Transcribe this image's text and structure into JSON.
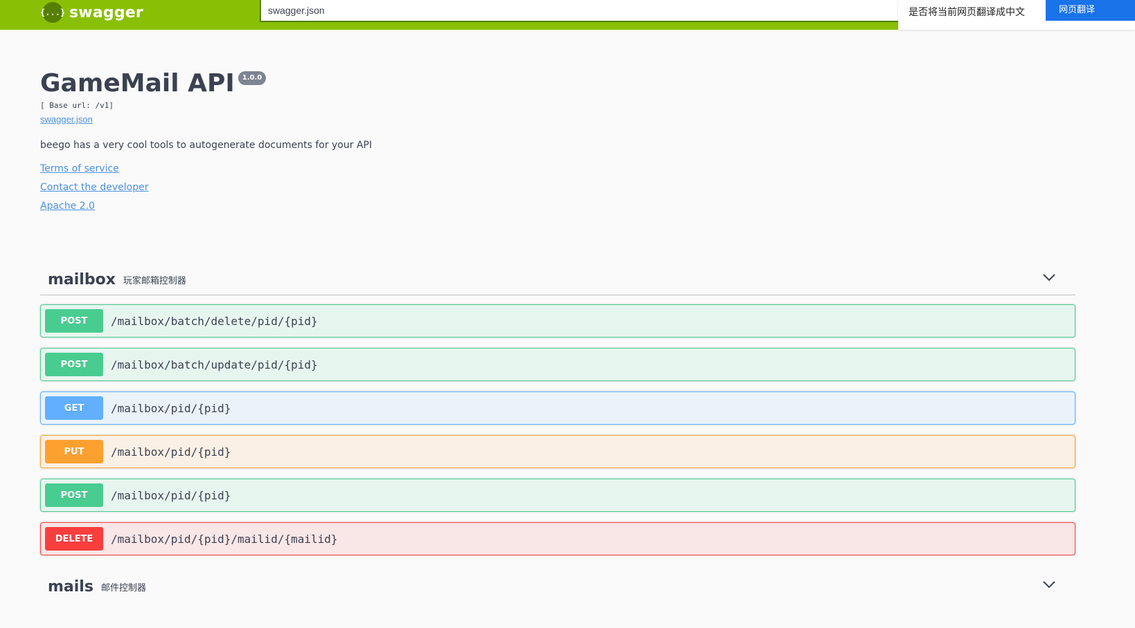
{
  "topbar": {
    "logo_icon_text": "{...}",
    "logo_text": "swagger",
    "url_value": "swagger.json"
  },
  "translate": {
    "prompt": "是否将当前网页翻译成中文",
    "button": "网页翻译"
  },
  "info": {
    "title": "GameMail API",
    "version": "1.0.0",
    "base_url": "[ Base url: /v1]",
    "spec_link": "swagger.json",
    "description": "beego has a very cool tools to autogenerate documents for your API",
    "links": {
      "terms": "Terms of service",
      "contact": "Contact the developer",
      "license": "Apache 2.0"
    }
  },
  "tags": [
    {
      "name": "mailbox",
      "description": "玩家邮箱控制器",
      "operations": [
        {
          "method": "POST",
          "path": "/mailbox/batch/delete/pid/{pid}"
        },
        {
          "method": "POST",
          "path": "/mailbox/batch/update/pid/{pid}"
        },
        {
          "method": "GET",
          "path": "/mailbox/pid/{pid}"
        },
        {
          "method": "PUT",
          "path": "/mailbox/pid/{pid}"
        },
        {
          "method": "POST",
          "path": "/mailbox/pid/{pid}"
        },
        {
          "method": "DELETE",
          "path": "/mailbox/pid/{pid}/mailid/{mailid}"
        }
      ]
    },
    {
      "name": "mails",
      "description": "邮件控制器",
      "operations": []
    }
  ],
  "colors": {
    "topbar": "#89bf04",
    "post": "#49cc90",
    "get": "#61affe",
    "put": "#fca130",
    "delete": "#f93e3e",
    "link": "#4990e2"
  }
}
